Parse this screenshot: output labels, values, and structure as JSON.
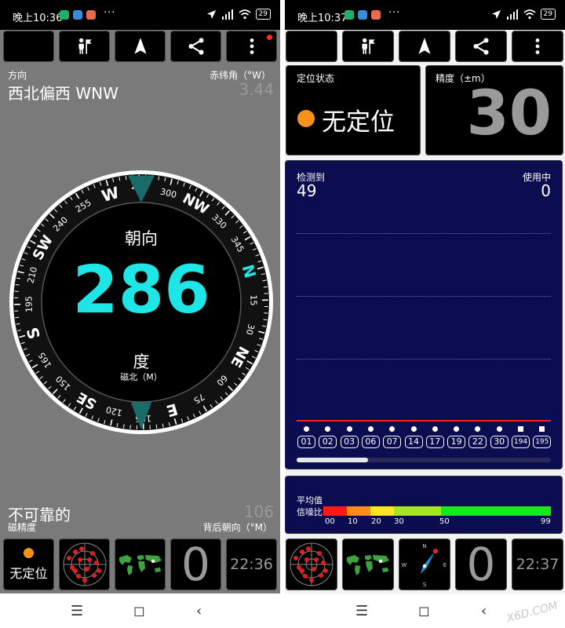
{
  "left": {
    "status": {
      "time": "晚上10:36",
      "dots": "···",
      "battery": "29"
    },
    "direction_label": "方向",
    "direction_value": "西北偏西 WNW",
    "declination_label": "赤纬角（°W）",
    "declination_value": "3.44",
    "compass": {
      "title": "朝向",
      "heading": "286",
      "unit": "度",
      "reference": "磁北（M）",
      "current_marker": "285",
      "back_marker": "105",
      "cardinal": [
        "N",
        "NE",
        "E",
        "SE",
        "S",
        "SW",
        "W",
        "NW"
      ],
      "degree_labels": [
        "15",
        "30",
        "60",
        "75",
        "105",
        "120",
        "150",
        "165",
        "195",
        "210",
        "240",
        "255",
        "285",
        "300",
        "330",
        "345"
      ]
    },
    "reliability_value": "不可靠的",
    "reliability_label": "磁精度",
    "back_heading_label": "背后朝向（°M）",
    "back_heading_value": "106",
    "bottom": {
      "fix_status": "无定位",
      "number": "0",
      "clock": "22:36"
    }
  },
  "right": {
    "status": {
      "time": "晚上10:37",
      "dots": "···",
      "battery": "29"
    },
    "fix_card": {
      "label": "定位状态",
      "value": "无定位"
    },
    "accuracy_card": {
      "label": "精度（±m）",
      "value": "30"
    },
    "satellites": {
      "detected_label": "检测到",
      "detected_value": "49",
      "used_label": "使用中",
      "used_value": "0",
      "ids": [
        "01",
        "02",
        "03",
        "06",
        "07",
        "14",
        "17",
        "19",
        "22",
        "30",
        "194",
        "195"
      ]
    },
    "snr": {
      "avg_label": "平均值",
      "snr_label": "信噪比",
      "ticks": [
        "00",
        "10",
        "20",
        "30",
        "50",
        "99"
      ]
    },
    "bottom": {
      "number": "0",
      "clock": "22:37"
    }
  },
  "watermark": "X6D.COM",
  "colors": {
    "accent": "#1ee6e6",
    "fix_dot": "#f7931a",
    "gps_bg": "#0c0c50",
    "signal_red": "#ff2020"
  }
}
